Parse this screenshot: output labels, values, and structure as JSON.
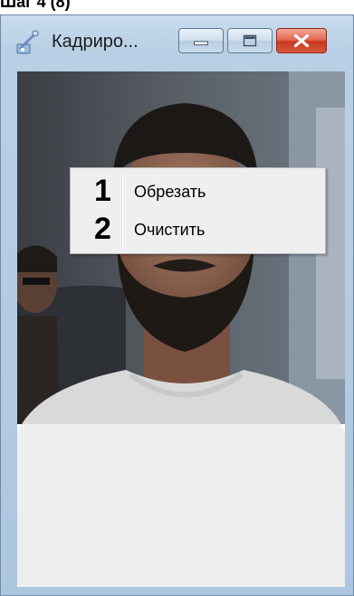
{
  "top_strip": {
    "text": "Шаг 4 (8)"
  },
  "window": {
    "title": "Кадриро...",
    "icons": {
      "app": "image-crop-icon",
      "minimize": "minimize-icon",
      "maximize": "maximize-icon",
      "close": "close-icon"
    },
    "colors": {
      "frame": "#b9cfe5",
      "close_button": "#d8593d"
    }
  },
  "context_menu": {
    "items": [
      {
        "number": "1",
        "label": "Обрезать"
      },
      {
        "number": "2",
        "label": "Очистить"
      }
    ]
  }
}
